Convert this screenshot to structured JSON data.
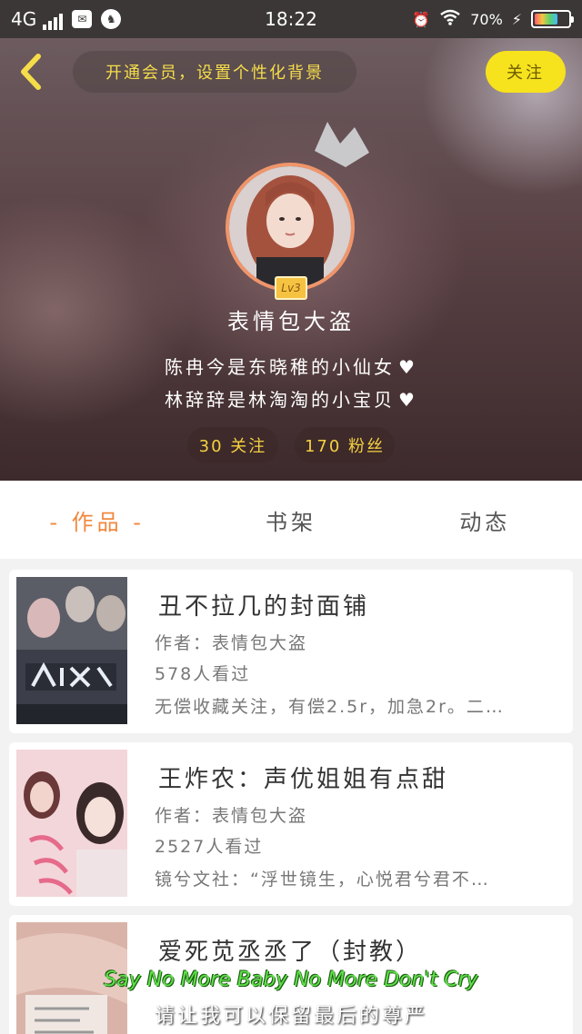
{
  "status_bar": {
    "network": "4G",
    "time": "18:22",
    "battery": "70%"
  },
  "header": {
    "vip_prompt": "开通会员，设置个性化背景",
    "follow_label": "关注",
    "level": "Lv3",
    "username": "表情包大盗",
    "bio_line1": "陈冉今是东晓稚的小仙女",
    "bio_line2": "林辞辞是林淘淘的小宝贝",
    "following": "30 关注",
    "fans": "170 粉丝"
  },
  "tabs": [
    {
      "label": "- 作品 -",
      "active": true
    },
    {
      "label": "书架",
      "active": false
    },
    {
      "label": "动态",
      "active": false
    }
  ],
  "works": [
    {
      "title": "丑不拉几的封面铺",
      "author": "作者：表情包大盗",
      "views": "578人看过",
      "desc": "无偿收藏关注，有偿2.5r，加急2r。二…"
    },
    {
      "title": "王炸农：声优姐姐有点甜",
      "author": "作者：表情包大盗",
      "views": "2527人看过",
      "desc": "镜兮文社：“浮世镜生，心悦君兮君不…"
    },
    {
      "title": "爱死苋丞丞了（封教）",
      "author": "",
      "views": "",
      "desc": ""
    }
  ],
  "overlay": {
    "line1": "Say No More Baby No More Don't Cry",
    "line2": "请让我可以保留最后的尊严"
  },
  "colors": {
    "accent_orange": "#f0883e",
    "follow_yellow": "#f7e21e",
    "stat_gold": "#f5d142"
  }
}
